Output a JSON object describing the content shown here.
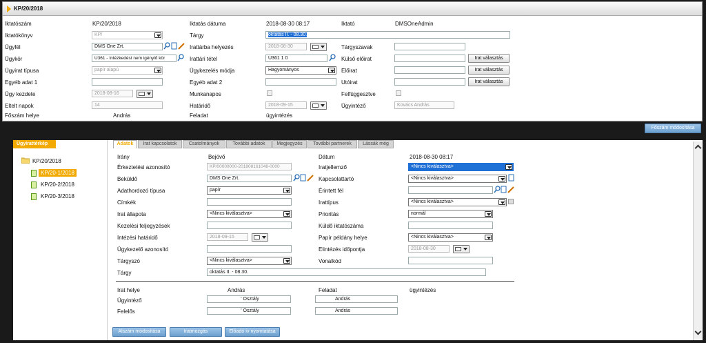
{
  "header": {
    "title": "KP/20/2018"
  },
  "top_left": [
    {
      "label": "Iktatószám",
      "value": "KP/20/2018"
    },
    {
      "label": "Iktatókönyv",
      "value": "KP/"
    },
    {
      "label": "Ügyfél",
      "value": "DMS One Zrt."
    },
    {
      "label": "Ügykör",
      "value": "U361 - Intézkedést nem igénylő kör"
    },
    {
      "label": "Ügyirat típusa",
      "value": "papír alapú"
    },
    {
      "label": "Egyéb adat 1",
      "value": ""
    },
    {
      "label": "Ügy kezdete",
      "value": "2018-08-16"
    },
    {
      "label": "Eltelt napok",
      "value": "14"
    },
    {
      "label": "Főszám helye",
      "value": "András"
    }
  ],
  "top_mid": [
    {
      "label": "Iktatás dátuma",
      "value": "2018-08-30 08:17"
    },
    {
      "label": "Tárgy",
      "value": "oktatás II. - 08.30."
    },
    {
      "label": "Irattárba helyezés",
      "value": "2018-08-30"
    },
    {
      "label": "Irattári tétel",
      "value": "U361 1 0"
    },
    {
      "label": "Ügykezelés módja",
      "value": "Hagyományos"
    },
    {
      "label": "Egyéb adat 2",
      "value": ""
    },
    {
      "label": "Munkanapos",
      "value": ""
    },
    {
      "label": "Határidő",
      "value": "2018-09-15"
    },
    {
      "label": "Feladat",
      "value": "ügyintézés"
    }
  ],
  "top_right": [
    {
      "label": "Iktató",
      "value": "DMSOneAdmin"
    },
    {
      "label": "Tárgyszavak",
      "value": ""
    },
    {
      "label": "Külső előirat",
      "value": ""
    },
    {
      "label": "Előirat",
      "value": ""
    },
    {
      "label": "Utóirat",
      "value": ""
    },
    {
      "label": "Felfüggesztve",
      "value": ""
    },
    {
      "label": "Ügyintéző",
      "value": "Kovács András"
    }
  ],
  "buttons": {
    "irat_valasztas": "Irat választás",
    "foszam_modositasa": "Főszám módosítása",
    "alszam_modositasa": "Alszám módosítása",
    "iratmozgas": "Iratmozgás",
    "eloado_iv": "Előadó ív nyomtatása"
  },
  "tree": {
    "tab": "Ügyirattérkép",
    "root": "KP/20/2018",
    "items": [
      "KP/20-1/2018",
      "KP/20-2/2018",
      "KP/20-3/2018"
    ]
  },
  "tabs": [
    "Adatok",
    "Irat kapcsolatok",
    "Csatolmányok",
    "További adatok",
    "Megjegyzés",
    "További partnerek",
    "Lássák még"
  ],
  "form_left": [
    {
      "label": "Irány",
      "value": "Bejövő"
    },
    {
      "label": "Érkeztetési azonosító",
      "value": "KP/00000000-201808161048-0000"
    },
    {
      "label": "Beküldő",
      "value": "DMS One Zrt."
    },
    {
      "label": "Adathordozó típusa",
      "value": "papír"
    },
    {
      "label": "Címkék",
      "value": ""
    },
    {
      "label": "Irat állapota",
      "value": "<Nincs kiválasztva>"
    },
    {
      "label": "Kezelési feljegyzések",
      "value": ""
    },
    {
      "label": "Intézési határidő",
      "value": "2018-09-15"
    },
    {
      "label": "Ügykezelő azonosító",
      "value": ""
    },
    {
      "label": "Tárgyszó",
      "value": "<Nincs kiválasztva>"
    },
    {
      "label": "Tárgy",
      "value": "oktatás II. - 08.30."
    }
  ],
  "form_right": [
    {
      "label": "Dátum",
      "value": "2018-08-30 08:17"
    },
    {
      "label": "Iratjellemző",
      "value": "<Nincs kiválasztva>"
    },
    {
      "label": "Kapcsolattartó",
      "value": "<Nincs kiválasztva>"
    },
    {
      "label": "Érintett fél",
      "value": ""
    },
    {
      "label": "Irattípus",
      "value": "<Nincs kiválasztva>"
    },
    {
      "label": "Prioritás",
      "value": "normál"
    },
    {
      "label": "Küldő iktatószáma",
      "value": ""
    },
    {
      "label": "Papír példány helye",
      "value": "<Nincs kiválasztva>"
    },
    {
      "label": "Elintézés időpontja",
      "value": "2018-08-30"
    },
    {
      "label": "Vonalkód",
      "value": ""
    }
  ],
  "bottom": {
    "irat_helye_label": "Irat helye",
    "irat_helye_val": "András",
    "feladat_label": "Feladat",
    "feladat_val": "ügyintézés",
    "ugyintezo_label": "Ügyintéző",
    "ugyintezo_osztaly": "' Osztály",
    "ugyintezo_nev": "András",
    "felelos_label": "Felelős",
    "felelos_osztaly": "' Osztály",
    "felelos_nev": "András"
  }
}
